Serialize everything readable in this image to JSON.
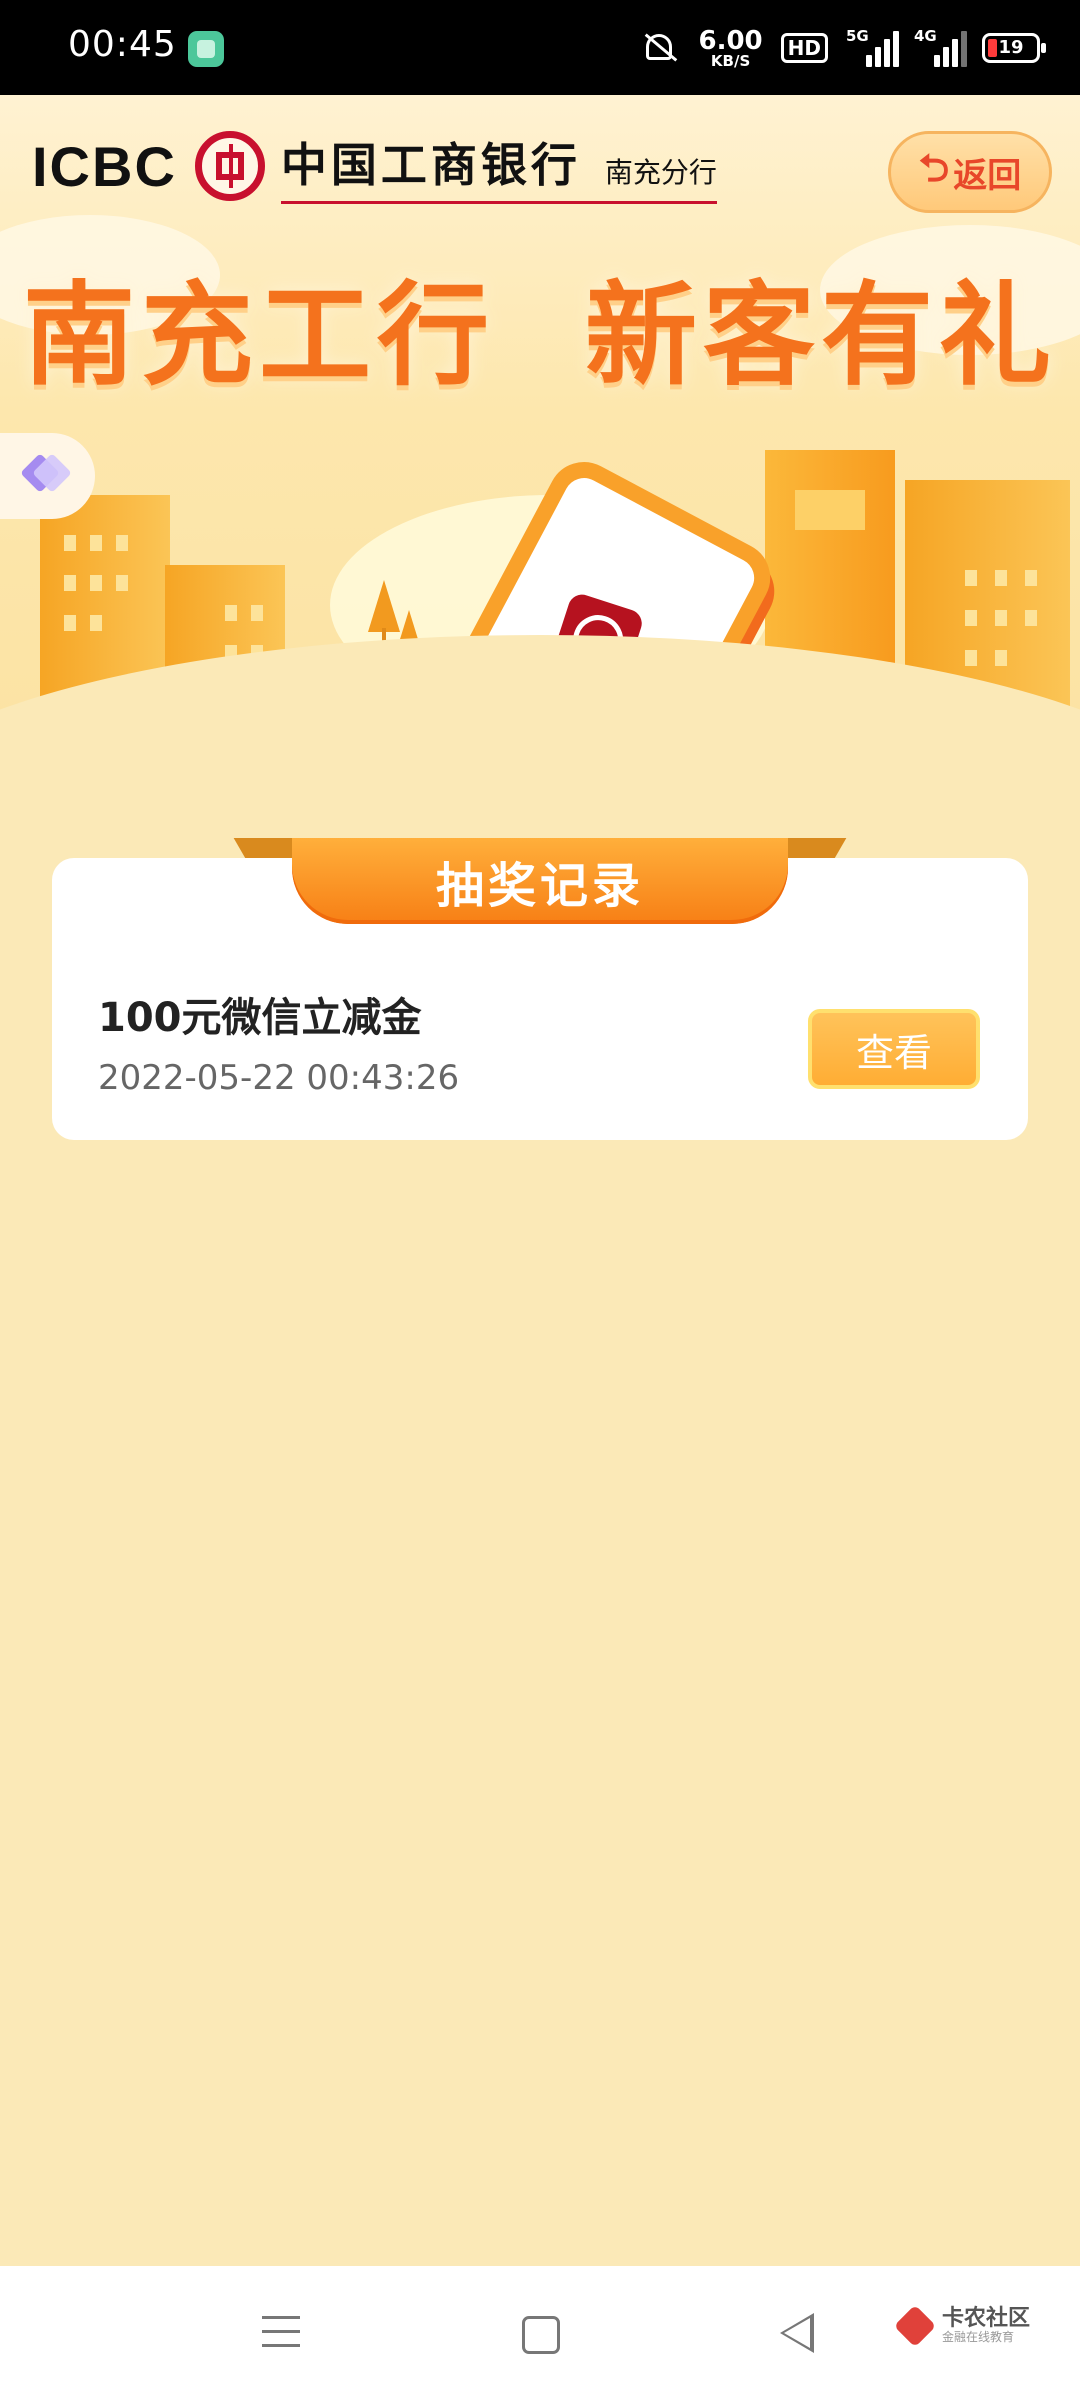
{
  "status_bar": {
    "time": "00:45",
    "net_speed_value": "6.00",
    "net_speed_unit": "KB/S",
    "hd_label": "HD",
    "signal_1_label": "5G",
    "signal_2_label": "4G",
    "battery_level": "19",
    "icons": [
      "app-notification-icon",
      "mute-icon",
      "hd-icon",
      "signal-icon",
      "battery-icon"
    ]
  },
  "header": {
    "brand": "ICBC",
    "bank_name": "中国工商银行",
    "branch_name": "南充分行",
    "back_button": "返回"
  },
  "banner": {
    "title": "南充工行  新客有礼"
  },
  "records": {
    "section_title": "抽奖记录",
    "items": [
      {
        "prize": "100元微信立减金",
        "time": "2022-05-22 00:43:26",
        "action": "查看"
      }
    ]
  },
  "nav_bar": {
    "watermark_main": "卡农社区",
    "watermark_sub": "金融在线教育"
  },
  "colors": {
    "page_bg": "#fbe9b7",
    "accent_orange": "#f77f15",
    "brand_red": "#c8102e",
    "button_yellow": "#ffad34"
  }
}
